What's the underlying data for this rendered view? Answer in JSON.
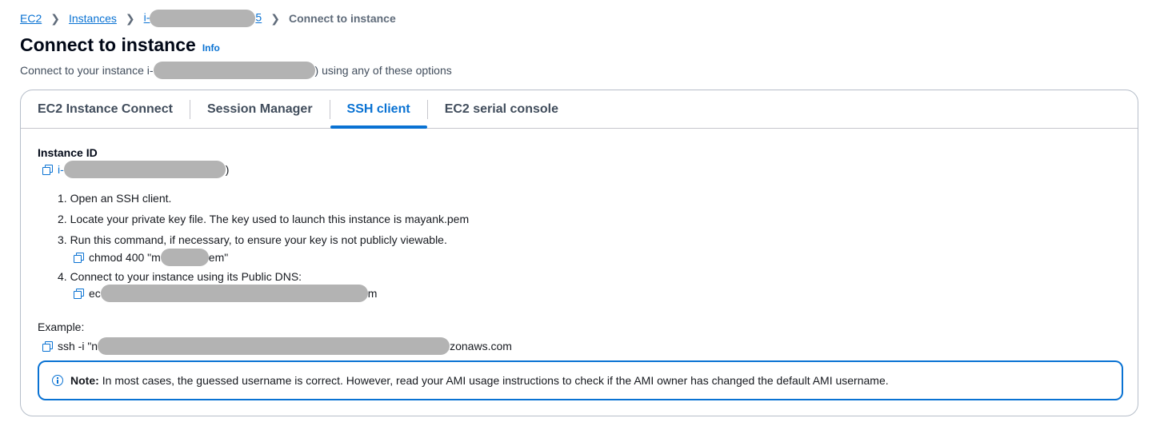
{
  "breadcrumb": {
    "ec2": "EC2",
    "instances": "Instances",
    "instance_id_prefix": "i-",
    "instance_id_suffix": "5",
    "current": "Connect to instance"
  },
  "header": {
    "title": "Connect to instance",
    "info_label": "Info",
    "subtitle_prefix": "Connect to your instance i-",
    "subtitle_suffix": ") using any of these options"
  },
  "tabs": [
    {
      "label": "EC2 Instance Connect",
      "active": false
    },
    {
      "label": "Session Manager",
      "active": false
    },
    {
      "label": "SSH client",
      "active": true
    },
    {
      "label": "EC2 serial console",
      "active": false
    }
  ],
  "ssh": {
    "instance_id_label": "Instance ID",
    "instance_id_prefix": "i-",
    "instance_id_suffix": ")",
    "step1": "1. Open an SSH client.",
    "step2": "2. Locate your private key file. The key used to launch this instance is mayank.pem",
    "step3": "3. Run this command, if necessary, to ensure your key is not publicly viewable.",
    "step3_cmd_prefix": "chmod 400 \"m",
    "step3_cmd_suffix": "em\"",
    "step4": "4. Connect to your instance using its Public DNS:",
    "step4_dns_prefix": "ec",
    "step4_dns_suffix": "m",
    "example_label": "Example:",
    "example_prefix": "ssh -i \"n",
    "example_suffix": "zonaws.com"
  },
  "note": {
    "bold": "Note:",
    "text": "In most cases, the guessed username is correct. However, read your AMI usage instructions to check if the AMI owner has changed the default AMI username."
  },
  "colors": {
    "accent": "#0972d3",
    "border": "#b6bec9",
    "redaction": "#b3b3b3"
  }
}
